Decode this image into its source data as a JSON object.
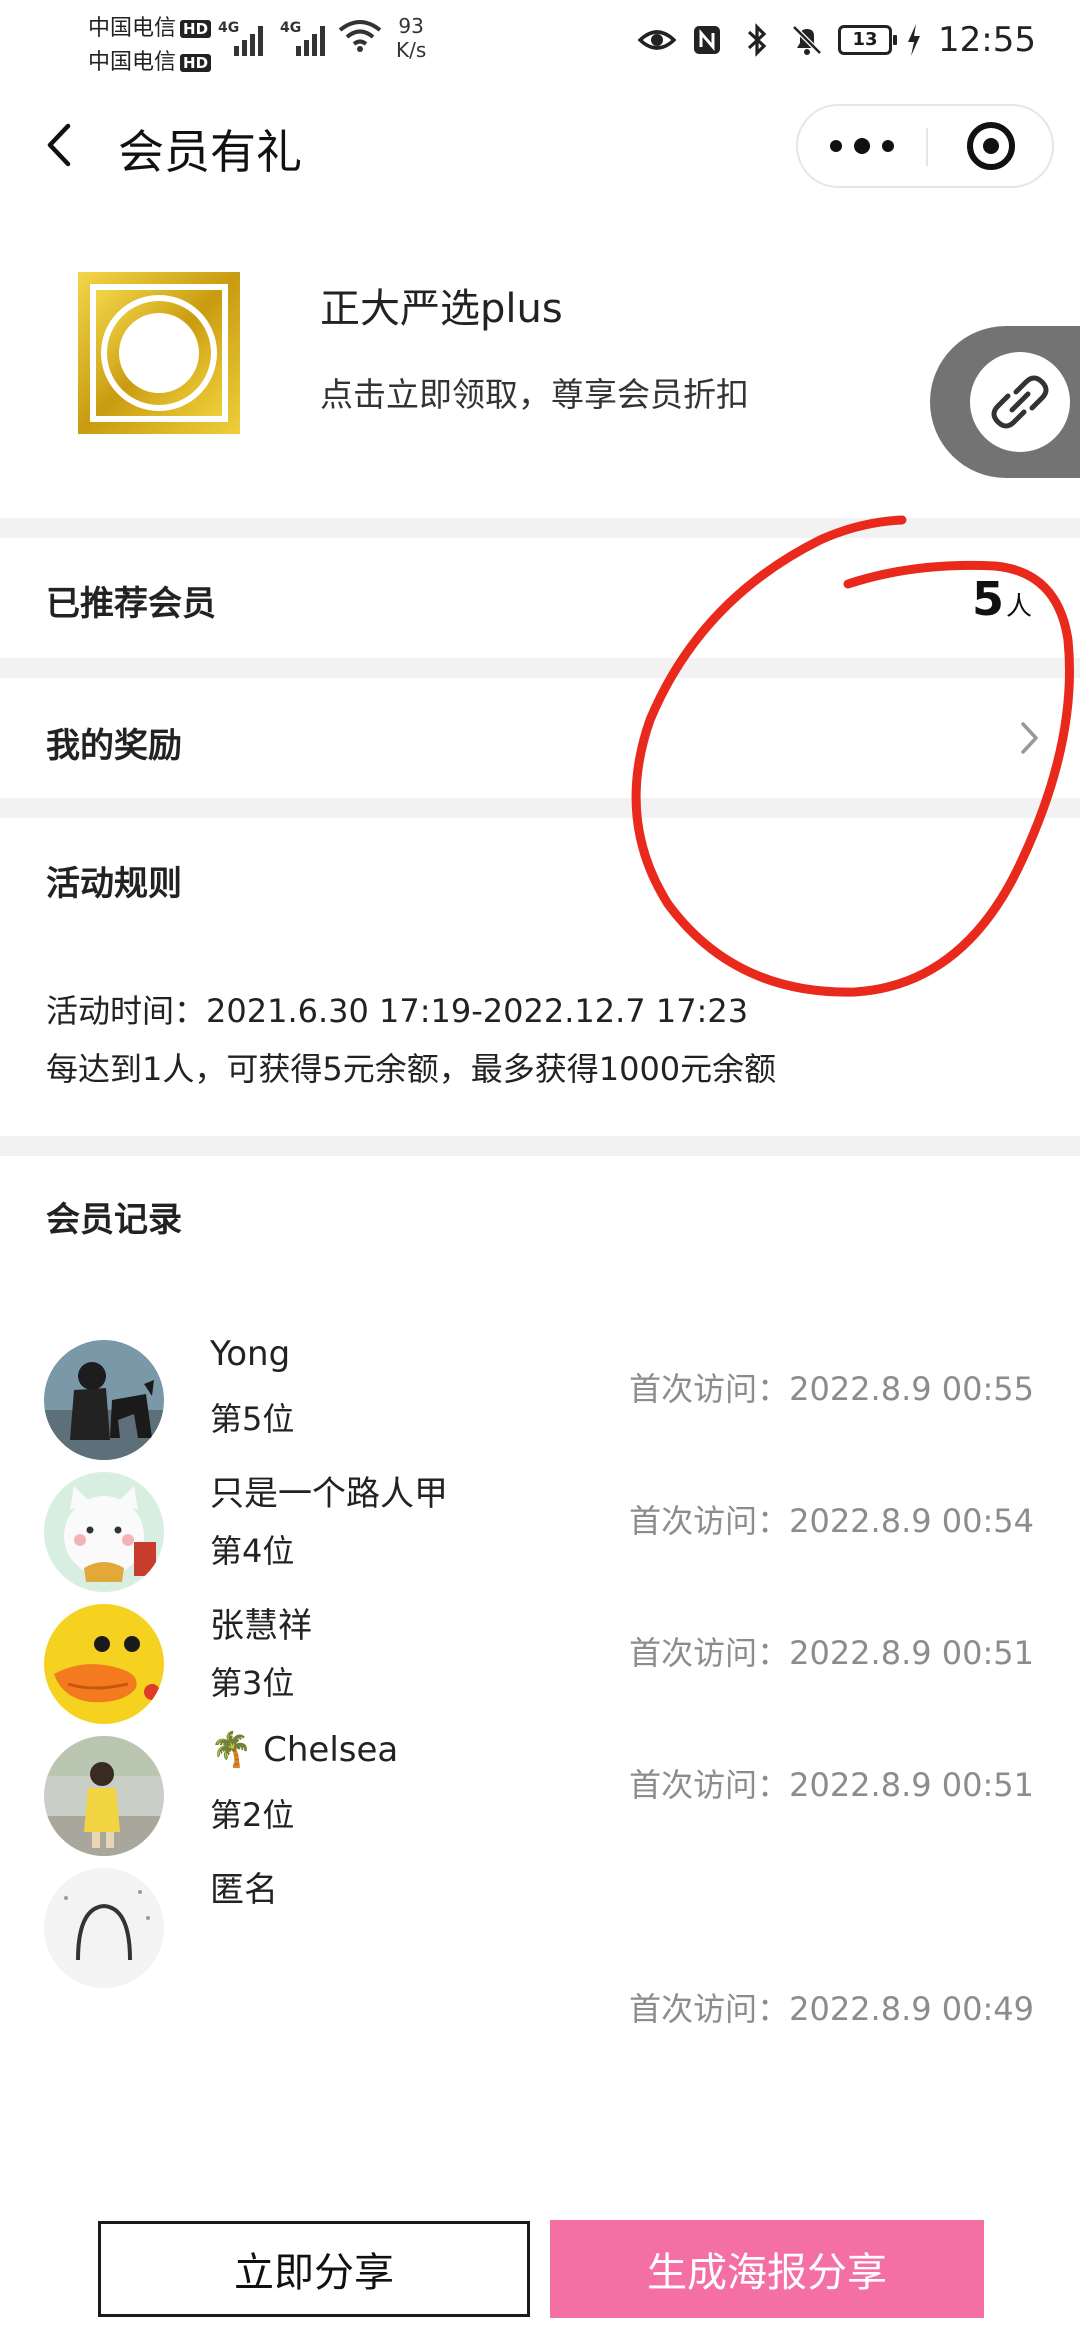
{
  "status_bar": {
    "carrier1": "中国电信",
    "carrier2": "中国电信",
    "hd_badge": "HD",
    "net_type_1": "4G",
    "net_type_2": "4G",
    "speed_value": "93",
    "speed_unit": "K/s",
    "battery": "13",
    "time": "12:55",
    "icons": [
      "eye-icon",
      "nfc-icon",
      "bluetooth-icon",
      "mute-bell-icon",
      "battery-icon",
      "charging-icon"
    ]
  },
  "nav": {
    "title": "会员有礼",
    "back_icon": "chevron-left-icon",
    "more_icon": "more-dots-icon",
    "close_icon": "target-circle-icon"
  },
  "profile": {
    "name": "正大严选plus",
    "subtitle": "点击立即领取，尊享会员折扣",
    "share_link_icon": "link-icon"
  },
  "recommended": {
    "label": "已推荐会员",
    "count": "5",
    "unit": "人"
  },
  "rewards": {
    "label": "我的奖励"
  },
  "rules": {
    "title": "活动规则",
    "time_line": "活动时间：2021.6.30 17:19-2022.12.7 17:23",
    "reward_line": "每达到1人，可获得5元余额，最多获得1000元余额"
  },
  "records": {
    "title": "会员记录",
    "items": [
      {
        "name": "Yong",
        "rank": "第5位",
        "visit": "首次访问：2022.8.9 00:55"
      },
      {
        "name": "只是一个路人甲",
        "rank": "第4位",
        "visit": "首次访问：2022.8.9 00:54"
      },
      {
        "name": "张慧祥",
        "rank": "第3位",
        "visit": "首次访问：2022.8.9 00:51"
      },
      {
        "name": "🌴 Chelsea",
        "rank": "第2位",
        "visit": "首次访问：2022.8.9 00:51"
      },
      {
        "name": "匿名",
        "rank": "",
        "visit": "首次访问：2022.8.9 00:49"
      }
    ]
  },
  "buttons": {
    "share_now": "立即分享",
    "poster_share": "生成海报分享"
  },
  "colors": {
    "poster_button": "#f46fa3",
    "annotation_red": "#e8291c",
    "logo_gold": "#d9b422",
    "section_gap": "#f2f2f2"
  }
}
